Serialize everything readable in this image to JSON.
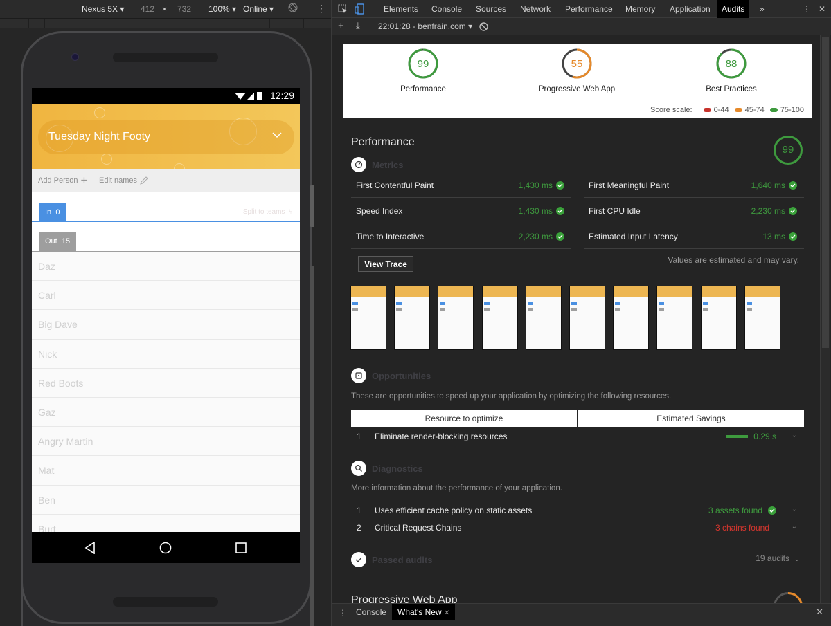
{
  "device_toolbar": {
    "device": "Nexus 5X",
    "width": "412",
    "times": "×",
    "height": "732",
    "zoom": "100%",
    "network": "Online"
  },
  "phone": {
    "status_time": "12:29",
    "group_name": "Tuesday Night Footy",
    "add_person": "Add Person",
    "edit_names": "Edit names",
    "in_label": "In",
    "in_count": "0",
    "split_label": "Split to teams",
    "out_label": "Out",
    "out_count": "15",
    "names": [
      "Daz",
      "Carl",
      "Big Dave",
      "Nick",
      "Red Boots",
      "Gaz",
      "Angry Martin",
      "Mat",
      "Ben",
      "Burt"
    ]
  },
  "devtools": {
    "tabs": [
      "Elements",
      "Console",
      "Sources",
      "Network",
      "Performance",
      "Memory",
      "Application",
      "Audits"
    ],
    "active_tab": "Audits",
    "more": "»",
    "report_selector": "22:01:28 - benfrain.com"
  },
  "scores": [
    {
      "label": "Performance",
      "value": "99",
      "fraction": 0.99,
      "color": "#3e9a3e"
    },
    {
      "label": "Progressive Web App",
      "value": "55",
      "fraction": 0.55,
      "color": "#e5892a"
    },
    {
      "label": "Best Practices",
      "value": "88",
      "fraction": 0.88,
      "color": "#3e9a3e"
    }
  ],
  "score_scale": {
    "label": "Score scale:",
    "items": [
      {
        "range": "0-44",
        "color": "#c7322b"
      },
      {
        "range": "45-74",
        "color": "#e5892a"
      },
      {
        "range": "75-100",
        "color": "#3e9a3e"
      }
    ]
  },
  "performance": {
    "title": "Performance",
    "score": "99",
    "metrics_title": "Metrics",
    "metrics": [
      {
        "name": "First Contentful Paint",
        "value": "1,430 ms"
      },
      {
        "name": "First Meaningful Paint",
        "value": "1,640 ms"
      },
      {
        "name": "Speed Index",
        "value": "1,430 ms"
      },
      {
        "name": "First CPU Idle",
        "value": "2,230 ms"
      },
      {
        "name": "Time to Interactive",
        "value": "2,230 ms"
      },
      {
        "name": "Estimated Input Latency",
        "value": "13 ms"
      }
    ],
    "view_trace": "View Trace",
    "estimated_note": "Values are estimated and may vary.",
    "opportunities_title": "Opportunities",
    "opportunities_desc": "These are opportunities to speed up your application by optimizing the following resources.",
    "opp_headers": [
      "Resource to optimize",
      "Estimated Savings"
    ],
    "opportunities": [
      {
        "n": "1",
        "title": "Eliminate render-blocking resources",
        "savings": "0.29 s"
      }
    ],
    "diagnostics_title": "Diagnostics",
    "diagnostics_desc": "More information about the performance of your application.",
    "diagnostics": [
      {
        "n": "1",
        "title": "Uses efficient cache policy on static assets",
        "value": "3 assets found",
        "status": "pass"
      },
      {
        "n": "2",
        "title": "Critical Request Chains",
        "value": "3 chains found",
        "status": "fail"
      }
    ],
    "passed_title": "Passed audits",
    "passed_count": "19 audits"
  },
  "pwa_section": {
    "title": "Progressive Web App"
  },
  "drawer": {
    "tabs": [
      "Console",
      "What's New"
    ],
    "active": "What's New"
  }
}
